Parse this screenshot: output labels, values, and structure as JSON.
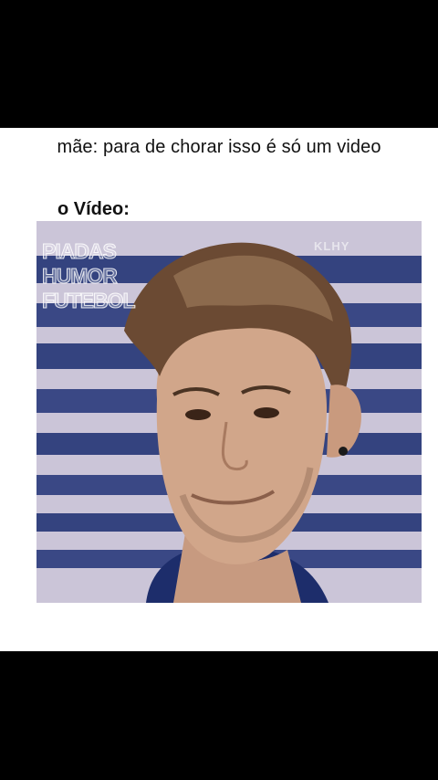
{
  "post": {
    "caption": "mãe: para de chorar isso é só um video",
    "sub_caption": "o Vídeo:"
  },
  "video": {
    "watermark_lines": [
      "PIADAS",
      "HUMOR",
      "FUTEBOL"
    ],
    "corner_mark": "KLHY"
  },
  "colors": {
    "background": "#000000",
    "card": "#ffffff",
    "stripe_light": "#d8d3e3",
    "stripe_dark": "#33427d"
  }
}
